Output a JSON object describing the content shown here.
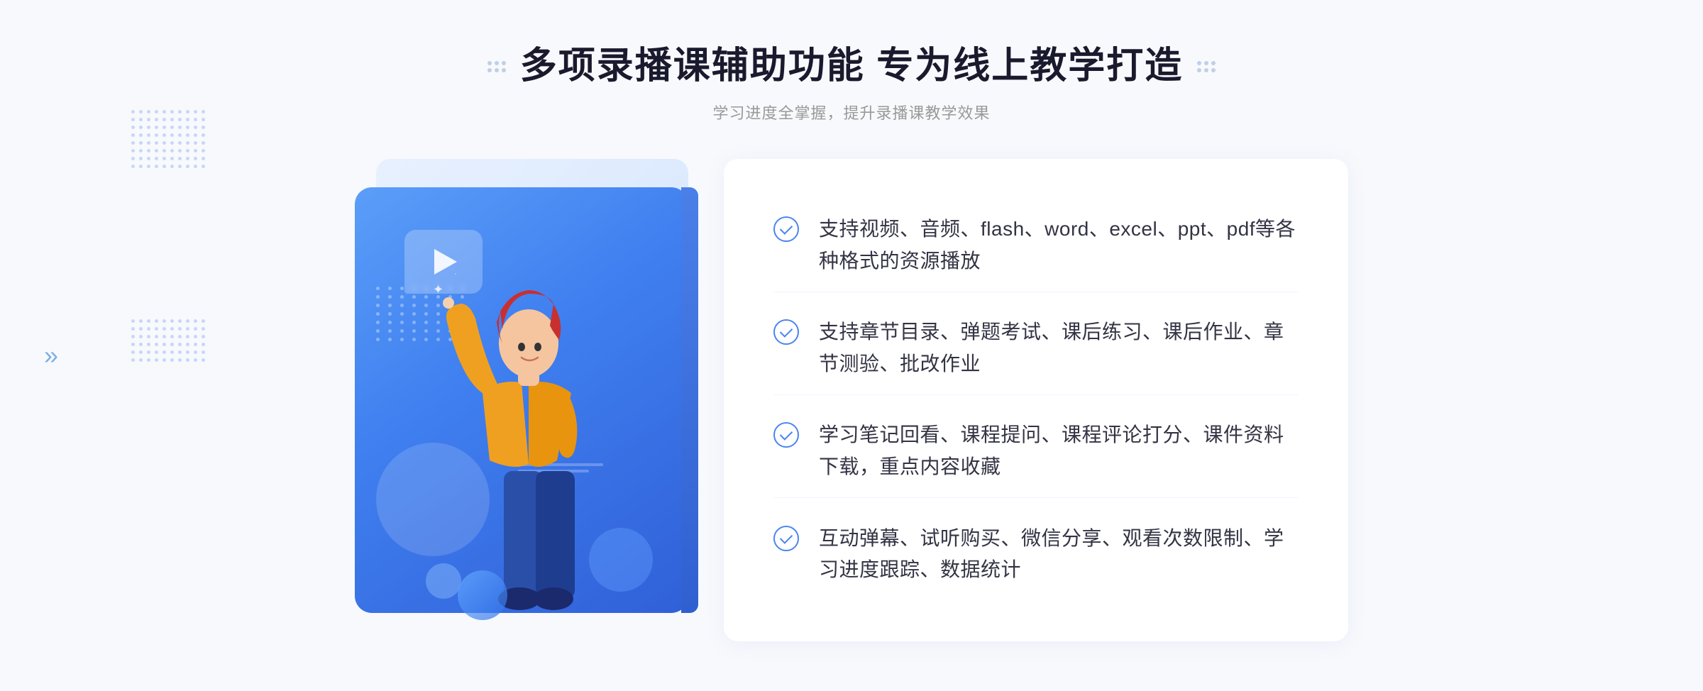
{
  "header": {
    "title": "多项录播课辅助功能 专为线上教学打造",
    "subtitle": "学习进度全掌握，提升录播课教学效果"
  },
  "features": [
    {
      "id": 1,
      "text": "支持视频、音频、flash、word、excel、ppt、pdf等各种格式的资源播放"
    },
    {
      "id": 2,
      "text": "支持章节目录、弹题考试、课后练习、课后作业、章节测验、批改作业"
    },
    {
      "id": 3,
      "text": "学习笔记回看、课程提问、课程评论打分、课件资料下载，重点内容收藏"
    },
    {
      "id": 4,
      "text": "互动弹幕、试听购买、微信分享、观看次数限制、学习进度跟踪、数据统计"
    }
  ],
  "decorations": {
    "chevron": "»",
    "play_icon": "▶"
  }
}
